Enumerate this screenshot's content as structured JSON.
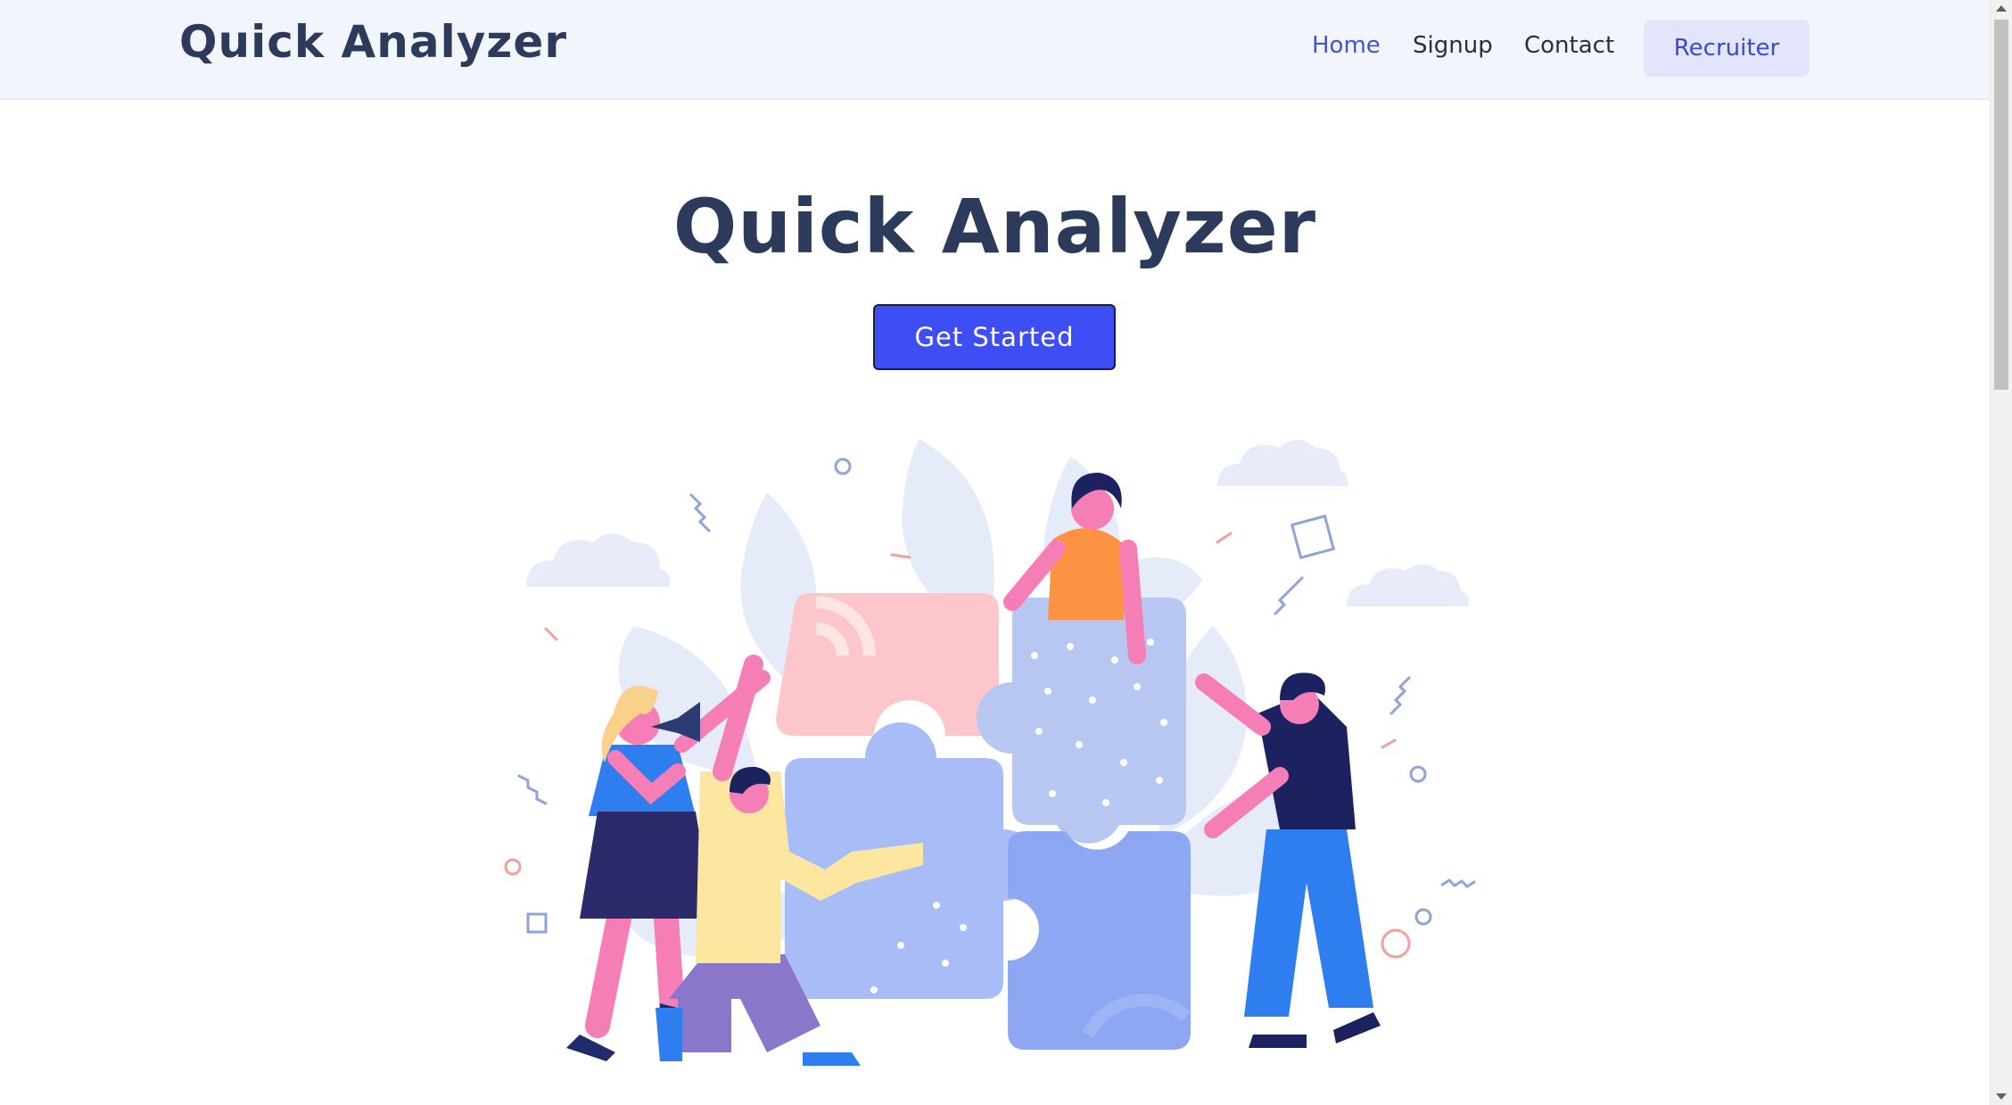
{
  "brand": {
    "name": "Quick Analyzer"
  },
  "nav": {
    "items": [
      {
        "label": "Home",
        "active": true
      },
      {
        "label": "Signup",
        "active": false
      },
      {
        "label": "Contact",
        "active": false
      }
    ],
    "recruiter_label": "Recruiter"
  },
  "hero": {
    "title": "Quick Analyzer",
    "cta_label": "Get Started",
    "illustration": "team-puzzle-illustration"
  },
  "colors": {
    "brand_text": "#2c3a5c",
    "accent": "#3d4ef5",
    "nav_active": "#4353d6",
    "navbar_bg": "#f3f5fd",
    "recruiter_bg": "#e2e5fb"
  }
}
